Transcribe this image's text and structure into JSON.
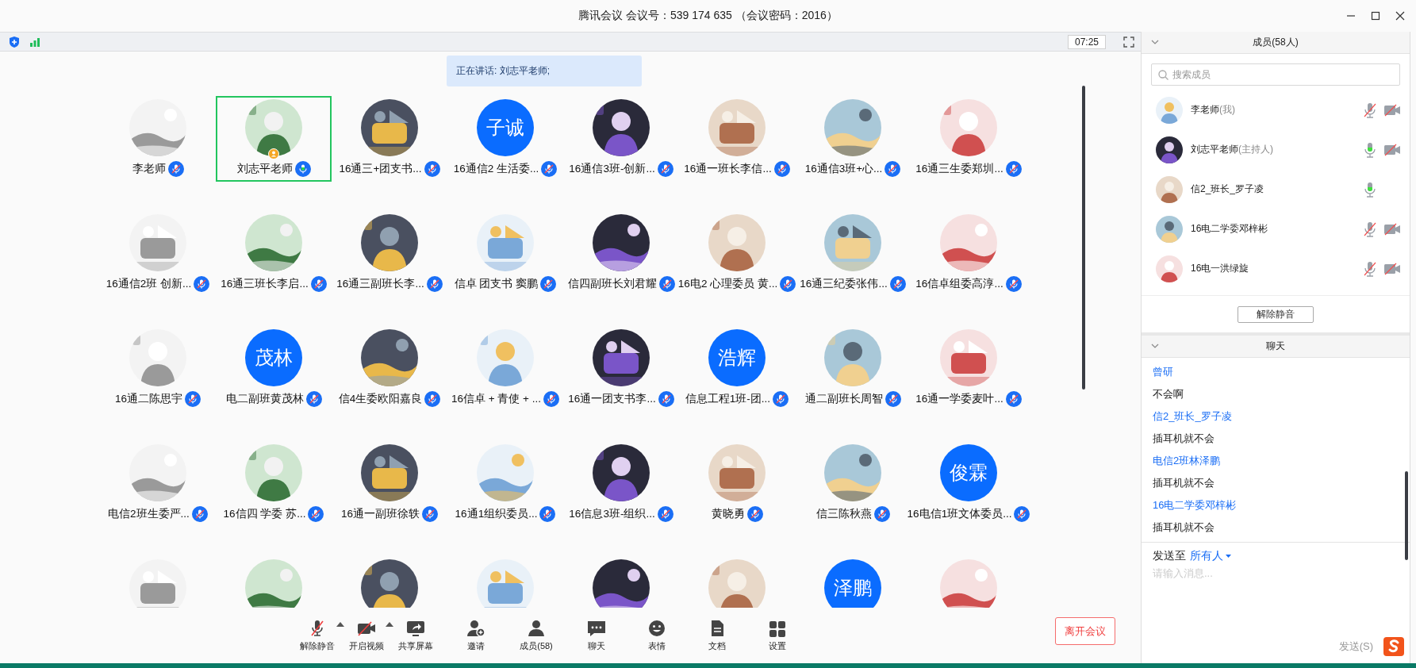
{
  "window": {
    "title": "腾讯会议 会议号：539 174 635 （会议密码：2016）"
  },
  "status_bar": {
    "timer": "07:25"
  },
  "speaker_banner": "正在讲话: 刘志平老师;",
  "participants": [
    {
      "name": "李老师",
      "muted": true,
      "speaking": false,
      "host": false
    },
    {
      "name": "刘志平老师",
      "muted": false,
      "speaking": true,
      "host": true
    },
    {
      "name": "16通三+团支书...",
      "muted": true,
      "speaking": false,
      "host": false
    },
    {
      "name": "16通信2 生活委...",
      "avatar": {
        "kind": "initials",
        "text": "子诚"
      },
      "muted": true,
      "speaking": false,
      "host": false
    },
    {
      "name": "16通信3班-创新...",
      "muted": true,
      "speaking": false,
      "host": false
    },
    {
      "name": "16通一班长李信...",
      "muted": true,
      "speaking": false,
      "host": false
    },
    {
      "name": "16通信3班+心...",
      "muted": true,
      "speaking": false,
      "host": false
    },
    {
      "name": "16通三生委郑圳...",
      "muted": true,
      "speaking": false,
      "host": false
    },
    {
      "name": "16通信2班 创新...",
      "muted": true,
      "speaking": false,
      "host": false
    },
    {
      "name": "16通三班长李启...",
      "muted": true,
      "speaking": false,
      "host": false
    },
    {
      "name": "16通三副班长李...",
      "muted": true,
      "speaking": false,
      "host": false
    },
    {
      "name": "信卓 团支书 窦鹏",
      "muted": true,
      "speaking": false,
      "host": false
    },
    {
      "name": "信四副班长刘君耀",
      "muted": true,
      "speaking": false,
      "host": false
    },
    {
      "name": "16电2 心理委员 黄...",
      "muted": true,
      "speaking": false,
      "host": false
    },
    {
      "name": "16通三纪委张伟...",
      "muted": true,
      "speaking": false,
      "host": false
    },
    {
      "name": "16信卓组委高淳...",
      "muted": true,
      "speaking": false,
      "host": false
    },
    {
      "name": "16通二陈思宇",
      "muted": true,
      "speaking": false,
      "host": false
    },
    {
      "name": "电二副班黄茂林",
      "avatar": {
        "kind": "initials",
        "text": "茂林"
      },
      "muted": true,
      "speaking": false,
      "host": false
    },
    {
      "name": "信4生委欧阳嘉良",
      "muted": true,
      "speaking": false,
      "host": false
    },
    {
      "name": "16信卓 + 青使 + ...",
      "muted": true,
      "speaking": false,
      "host": false
    },
    {
      "name": "16通一团支书李...",
      "muted": true,
      "speaking": false,
      "host": false
    },
    {
      "name": "信息工程1班-团...",
      "avatar": {
        "kind": "initials",
        "text": "浩辉"
      },
      "muted": true,
      "speaking": false,
      "host": false
    },
    {
      "name": "通二副班长周智",
      "muted": true,
      "speaking": false,
      "host": false
    },
    {
      "name": "16通一学委麦叶...",
      "muted": true,
      "speaking": false,
      "host": false
    },
    {
      "name": "电信2班生委严...",
      "muted": true,
      "speaking": false,
      "host": false
    },
    {
      "name": "16信四 学委 苏...",
      "muted": true,
      "speaking": false,
      "host": false
    },
    {
      "name": "16通一副班徐轶",
      "muted": true,
      "speaking": false,
      "host": false
    },
    {
      "name": "16通1组织委员...",
      "muted": true,
      "speaking": false,
      "host": false
    },
    {
      "name": "16信息3班-组织...",
      "muted": true,
      "speaking": false,
      "host": false
    },
    {
      "name": "黄晓勇",
      "muted": true,
      "speaking": false,
      "host": false
    },
    {
      "name": "信三陈秋燕",
      "muted": true,
      "speaking": false,
      "host": false
    },
    {
      "name": "16电信1班文体委员...",
      "avatar": {
        "kind": "initials",
        "text": "俊霖"
      },
      "muted": true,
      "speaking": false,
      "host": false
    },
    {
      "speaking": false,
      "host": false
    },
    {
      "speaking": false,
      "host": false
    },
    {
      "speaking": false,
      "host": false
    },
    {
      "speaking": false,
      "host": false
    },
    {
      "speaking": false,
      "host": false
    },
    {
      "speaking": false,
      "host": false
    },
    {
      "avatar": {
        "kind": "initials",
        "text": "泽鹏"
      },
      "speaking": false,
      "host": false
    },
    {
      "speaking": false,
      "host": false
    }
  ],
  "toolbar": [
    {
      "label": "解除静音",
      "has_menu": true
    },
    {
      "label": "开启视频",
      "has_menu": true
    },
    {
      "label": "共享屏幕",
      "has_menu": false
    },
    {
      "label": "邀请",
      "has_menu": false
    },
    {
      "label": "成员(58)",
      "has_menu": false
    },
    {
      "label": "聊天",
      "has_menu": false
    },
    {
      "label": "表情",
      "has_menu": false
    },
    {
      "label": "文档",
      "has_menu": false
    },
    {
      "label": "设置",
      "has_menu": false
    }
  ],
  "leave_button": "离开会议",
  "members_panel": {
    "title": "成员(58人)",
    "search": {
      "placeholder": "搜索成员"
    },
    "members": [
      {
        "name": "李老师",
        "role": "(我)",
        "muted": true,
        "camera_icon": true
      },
      {
        "name": "刘志平老师",
        "role": "(主持人)",
        "muted": false,
        "camera_icon": true
      },
      {
        "name": "信2_班长_罗子凌",
        "muted": false,
        "camera_icon": false
      },
      {
        "name": "16电二学委邓梓彬",
        "muted": true,
        "camera_icon": true
      },
      {
        "name": "16电一洪绿旋",
        "muted": true,
        "camera_icon": true
      }
    ],
    "unmute_button": "解除静音"
  },
  "chat_panel": {
    "title": "聊天",
    "messages": [
      {
        "sender": "曾研",
        "text": "不会啊"
      },
      {
        "sender": "信2_班长_罗子凌",
        "text": "插耳机就不会"
      },
      {
        "sender": "电信2班林泽鹏",
        "text": "插耳机就不会"
      },
      {
        "sender": "16电二学委邓梓彬",
        "text": "插耳机就不会"
      }
    ],
    "send_to_label": "发送至",
    "send_to_target": "所有人",
    "input": {
      "placeholder": "请输入消息..."
    },
    "send_button": "发送(S)"
  }
}
